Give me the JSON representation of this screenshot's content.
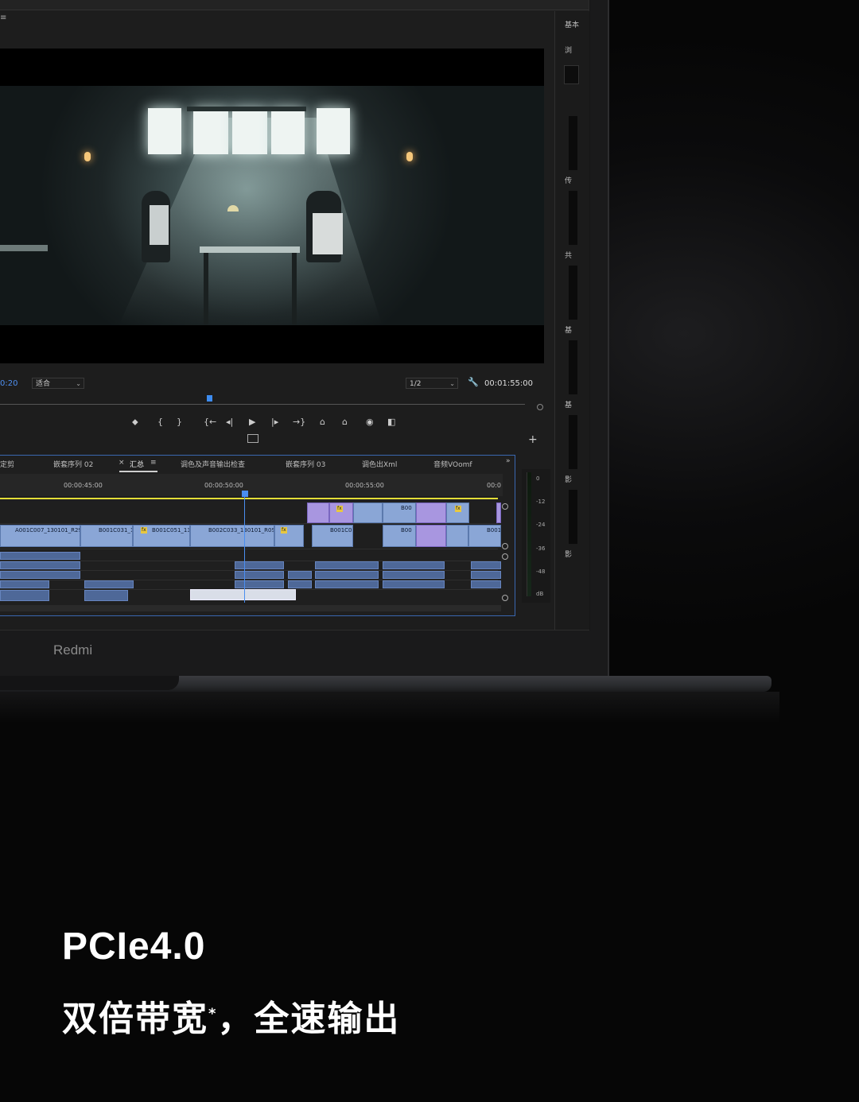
{
  "brand": "Redmi",
  "headline": "PCIe4.0",
  "subline_main": "双倍带宽",
  "subline_mark": "*",
  "subline_rest": "，全速输出",
  "menu_icon": "≡",
  "monitor": {
    "timecode_left": "0:20",
    "fit_select": "适合",
    "resolution_select": "1/2",
    "timecode_right": "00:01:55:00",
    "wrench_icon": "wrench-icon"
  },
  "transport": {
    "marker": "⬥",
    "in": "{",
    "out": "}",
    "goto_in": "{←",
    "step_back": "◂|",
    "play": "▶",
    "step_fwd": "|▸",
    "goto_out": "→}",
    "lift": "⌂",
    "extract": "⌂",
    "export_frame": "◉",
    "compare": "◧",
    "add": "+"
  },
  "right_panel": {
    "labels": [
      "基本",
      "浏",
      "传",
      "共",
      "基",
      "基",
      "影",
      "影"
    ]
  },
  "timeline": {
    "tabs": [
      "定剪",
      "嵌套序列 02",
      "×",
      "汇总",
      "≡",
      "调色及声音输出检查",
      "嵌套序列 03",
      "调色出Xml",
      "音频VOomf",
      "»"
    ],
    "ruler": [
      "00:00:45:00",
      "00:00:50:00",
      "00:00:55:00",
      "00:0"
    ],
    "clips_v2": [
      "B00"
    ],
    "clips_v1": [
      "A001C007_130101_R29",
      "B001C031_1",
      "B001C051_13",
      "B002C033_130101_R0S",
      "B001C0",
      "B00",
      "B001"
    ]
  },
  "meter": {
    "labels": [
      "0",
      "-12",
      "-24",
      "-36",
      "-48",
      "dB"
    ]
  },
  "colors": {
    "accent": "#4e8ff0",
    "clip_video": "#8aa6d6",
    "clip_purple": "#a896e0",
    "clip_audio": "#4e6898",
    "work_area": "#e4de38"
  }
}
